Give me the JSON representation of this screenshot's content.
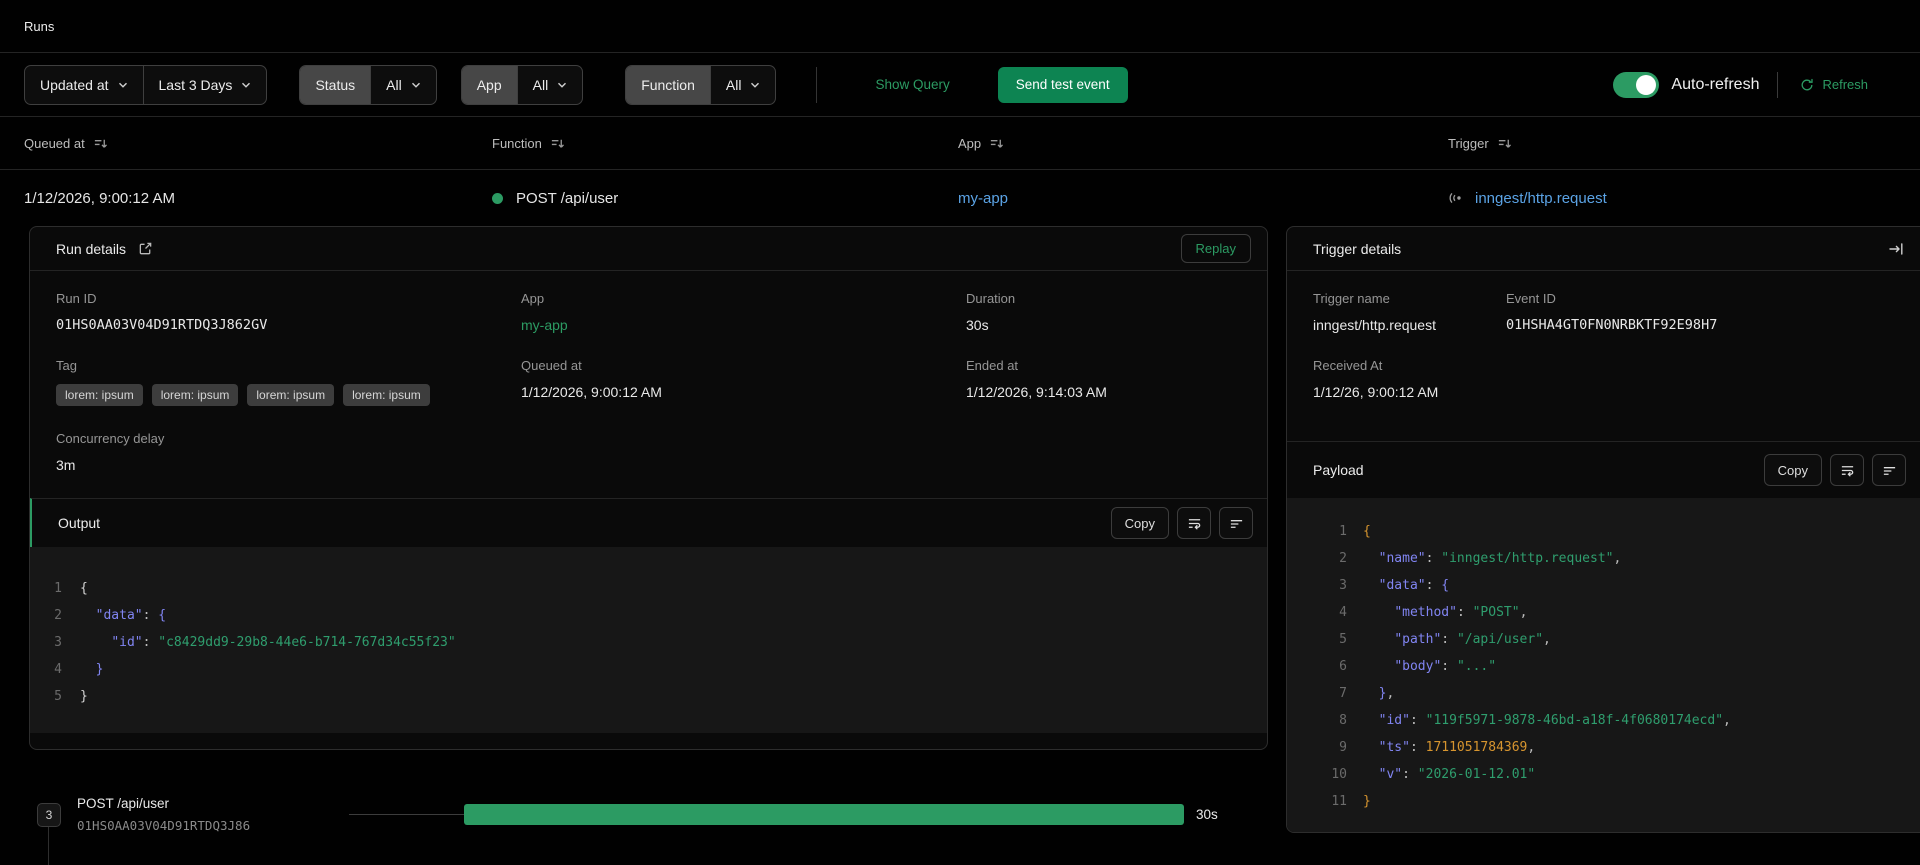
{
  "page": {
    "title": "Runs"
  },
  "filters": {
    "sort_field": "Updated at",
    "time_range": "Last 3 Days",
    "status": {
      "label": "Status",
      "value": "All"
    },
    "app": {
      "label": "App",
      "value": "All"
    },
    "function": {
      "label": "Function",
      "value": "All"
    },
    "show_query": "Show Query",
    "send_test_event": "Send test event",
    "auto_refresh_label": "Auto-refresh",
    "refresh_label": "Refresh"
  },
  "table": {
    "columns": {
      "queued_at": "Queued at",
      "function": "Function",
      "app": "App",
      "trigger": "Trigger"
    },
    "row": {
      "queued_at": "1/12/2026, 9:00:12 AM",
      "function": "POST /api/user",
      "app": "my-app",
      "trigger": "inngest/http.request"
    }
  },
  "run_details": {
    "title": "Run details",
    "replay_label": "Replay",
    "fields": {
      "run_id_label": "Run ID",
      "run_id": "01HS0AA03V04D91RTDQ3J862GV",
      "app_label": "App",
      "app": "my-app",
      "duration_label": "Duration",
      "duration": "30s",
      "tag_label": "Tag",
      "queued_at_label": "Queued at",
      "queued_at": "1/12/2026, 9:00:12 AM",
      "ended_at_label": "Ended at",
      "ended_at": "1/12/2026, 9:14:03 AM",
      "concurrency_delay_label": "Concurrency delay",
      "concurrency_delay": "3m"
    },
    "tags": [
      "lorem: ipsum",
      "lorem: ipsum",
      "lorem: ipsum",
      "lorem: ipsum"
    ],
    "output": {
      "title": "Output",
      "copy_label": "Copy",
      "lines": [
        [
          [
            "plain",
            "{"
          ]
        ],
        [
          [
            "punct",
            "  "
          ],
          [
            "key",
            "\"data\""
          ],
          [
            "punct",
            ": "
          ],
          [
            "brace1",
            "{"
          ]
        ],
        [
          [
            "punct",
            "    "
          ],
          [
            "key",
            "\"id\""
          ],
          [
            "punct",
            ": "
          ],
          [
            "str",
            "\"c8429dd9-29b8-44e6-b714-767d34c55f23\""
          ]
        ],
        [
          [
            "punct",
            "  "
          ],
          [
            "brace1",
            "}"
          ]
        ],
        [
          [
            "plain",
            "}"
          ]
        ]
      ]
    }
  },
  "trigger_details": {
    "title": "Trigger details",
    "fields": {
      "trigger_name_label": "Trigger name",
      "trigger_name": "inngest/http.request",
      "event_id_label": "Event ID",
      "event_id": "01HSHA4GT0FN0NRBKTF92E98H7",
      "received_at_label": "Received At",
      "received_at": "1/12/26, 9:00:12 AM"
    },
    "payload": {
      "title": "Payload",
      "copy_label": "Copy",
      "lines": [
        [
          [
            "brace0",
            "{"
          ]
        ],
        [
          [
            "punct",
            "  "
          ],
          [
            "key",
            "\"name\""
          ],
          [
            "punct",
            ": "
          ],
          [
            "str",
            "\"inngest/http.request\""
          ],
          [
            "punct",
            ","
          ]
        ],
        [
          [
            "punct",
            "  "
          ],
          [
            "key",
            "\"data\""
          ],
          [
            "punct",
            ": "
          ],
          [
            "brace1",
            "{"
          ]
        ],
        [
          [
            "punct",
            "    "
          ],
          [
            "key",
            "\"method\""
          ],
          [
            "punct",
            ": "
          ],
          [
            "str",
            "\"POST\""
          ],
          [
            "punct",
            ","
          ]
        ],
        [
          [
            "punct",
            "    "
          ],
          [
            "key",
            "\"path\""
          ],
          [
            "punct",
            ": "
          ],
          [
            "str",
            "\"/api/user\""
          ],
          [
            "punct",
            ","
          ]
        ],
        [
          [
            "punct",
            "    "
          ],
          [
            "key",
            "\"body\""
          ],
          [
            "punct",
            ": "
          ],
          [
            "str",
            "\"...\""
          ]
        ],
        [
          [
            "punct",
            "  "
          ],
          [
            "brace1",
            "}"
          ],
          [
            "punct",
            ","
          ]
        ],
        [
          [
            "punct",
            "  "
          ],
          [
            "key",
            "\"id\""
          ],
          [
            "punct",
            ": "
          ],
          [
            "str",
            "\"119f5971-9878-46bd-a18f-4f0680174ecd\""
          ],
          [
            "punct",
            ","
          ]
        ],
        [
          [
            "punct",
            "  "
          ],
          [
            "key",
            "\"ts\""
          ],
          [
            "punct",
            ": "
          ],
          [
            "num",
            "1711051784369"
          ],
          [
            "punct",
            ","
          ]
        ],
        [
          [
            "punct",
            "  "
          ],
          [
            "key",
            "\"v\""
          ],
          [
            "punct",
            ": "
          ],
          [
            "str",
            "\"2026-01-12.01\""
          ]
        ],
        [
          [
            "brace0",
            "}"
          ]
        ]
      ]
    }
  },
  "timeline": {
    "badge": "3",
    "step_name": "POST /api/user",
    "step_id": "01HS0AA03V04D91RTDQ3J86",
    "duration": "30s"
  },
  "colors": {
    "accent_green": "#2c9b63",
    "button_green": "#0d8452",
    "link_blue": "#5ba3e5",
    "code_key": "#8185f2",
    "code_string": "#2f9e6e",
    "code_number": "#d7952f"
  }
}
